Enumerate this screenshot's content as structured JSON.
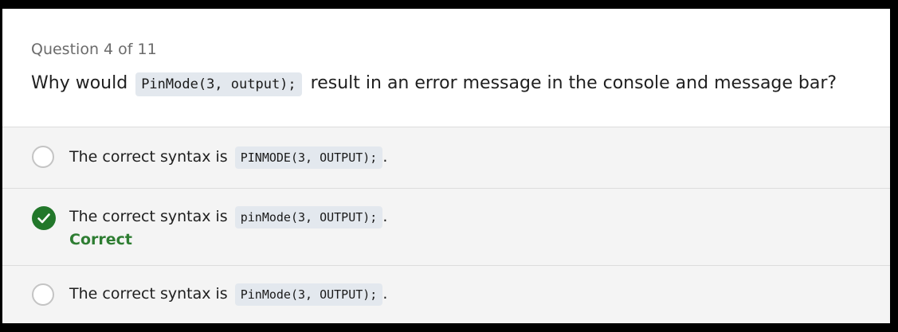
{
  "question": {
    "counter": "Question 4 of 11",
    "prefix": "Why would",
    "code": "PinMode(3, output);",
    "suffix": "result in an error message in the console and message bar?"
  },
  "options": [
    {
      "text": "The correct syntax is",
      "code": "PINMODE(3, OUTPUT);",
      "end": ".",
      "state": "unselected"
    },
    {
      "text": "The correct syntax is",
      "code": "pinMode(3, OUTPUT);",
      "end": ".",
      "state": "selected-correct",
      "feedback": "Correct"
    },
    {
      "text": "The correct syntax is",
      "code": "PinMode(3, OUTPUT);",
      "end": ".",
      "state": "unselected"
    }
  ],
  "colors": {
    "correct": "#22772a",
    "code_bg": "#e3e8ee",
    "options_bg": "#f4f4f4"
  },
  "icons": {
    "correct_option": "check-circle-icon",
    "other_options": "radio-button-icon"
  }
}
